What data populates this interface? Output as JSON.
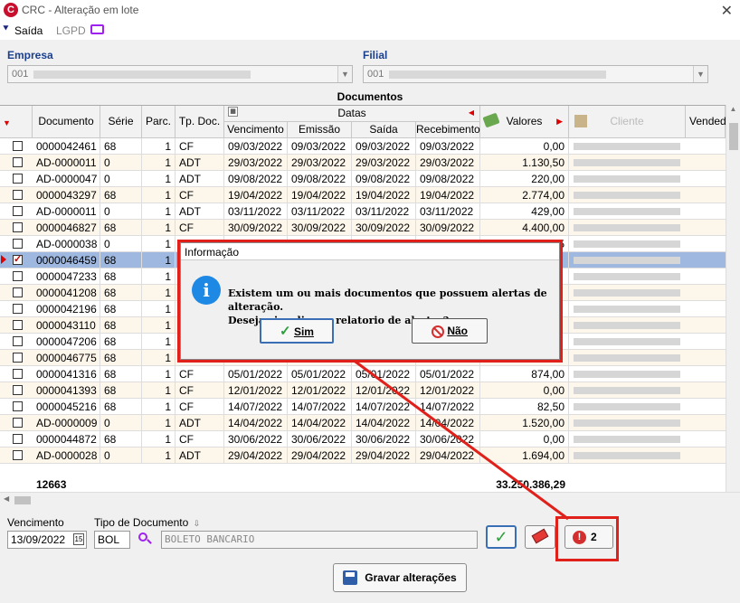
{
  "window": {
    "title": "CRC - Alteração em lote",
    "close": "✕"
  },
  "menu": {
    "saida": "Saída",
    "lgpd": "LGPD"
  },
  "empresa": {
    "label": "Empresa",
    "value": "001"
  },
  "filial": {
    "label": "Filial",
    "value": "001"
  },
  "documentos_title": "Documentos",
  "columns": {
    "documento": "Documento",
    "serie": "Série",
    "parc": "Parc.",
    "tpdoc": "Tp. Doc.",
    "datas": "Datas",
    "vencimento": "Vencimento",
    "emissao": "Emissão",
    "saida": "Saída",
    "recebimento": "Recebimento",
    "valores": "Valores",
    "cliente": "Cliente",
    "vendedor": "Vendedo"
  },
  "rows": [
    {
      "doc": "0000042461",
      "serie": "68",
      "parc": "1",
      "tp": "CF",
      "venc": "09/03/2022",
      "emis": "09/03/2022",
      "saida": "09/03/2022",
      "receb": "09/03/2022",
      "valor": "0,00"
    },
    {
      "doc": "AD-0000011",
      "serie": "0",
      "parc": "1",
      "tp": "ADT",
      "venc": "29/03/2022",
      "emis": "29/03/2022",
      "saida": "29/03/2022",
      "receb": "29/03/2022",
      "valor": "1.130,50"
    },
    {
      "doc": "AD-0000047",
      "serie": "0",
      "parc": "1",
      "tp": "ADT",
      "venc": "09/08/2022",
      "emis": "09/08/2022",
      "saida": "09/08/2022",
      "receb": "09/08/2022",
      "valor": "220,00"
    },
    {
      "doc": "0000043297",
      "serie": "68",
      "parc": "1",
      "tp": "CF",
      "venc": "19/04/2022",
      "emis": "19/04/2022",
      "saida": "19/04/2022",
      "receb": "19/04/2022",
      "valor": "2.774,00"
    },
    {
      "doc": "AD-0000011",
      "serie": "0",
      "parc": "1",
      "tp": "ADT",
      "venc": "03/11/2022",
      "emis": "03/11/2022",
      "saida": "03/11/2022",
      "receb": "03/11/2022",
      "valor": "429,00"
    },
    {
      "doc": "0000046827",
      "serie": "68",
      "parc": "1",
      "tp": "CF",
      "venc": "30/09/2022",
      "emis": "30/09/2022",
      "saida": "30/09/2022",
      "receb": "30/09/2022",
      "valor": "4.400,00"
    },
    {
      "doc": "AD-0000038",
      "serie": "0",
      "parc": "1",
      "tp": "",
      "venc": "",
      "emis": "",
      "saida": "",
      "receb": "",
      "valor": "5"
    },
    {
      "doc": "0000046459",
      "serie": "68",
      "parc": "1",
      "tp": "",
      "venc": "",
      "emis": "",
      "saida": "",
      "receb": "",
      "valor": ""
    },
    {
      "doc": "0000047233",
      "serie": "68",
      "parc": "1",
      "tp": "",
      "venc": "",
      "emis": "",
      "saida": "",
      "receb": "",
      "valor": ""
    },
    {
      "doc": "0000041208",
      "serie": "68",
      "parc": "1",
      "tp": "",
      "venc": "",
      "emis": "",
      "saida": "",
      "receb": "",
      "valor": ""
    },
    {
      "doc": "0000042196",
      "serie": "68",
      "parc": "1",
      "tp": "",
      "venc": "",
      "emis": "",
      "saida": "",
      "receb": "",
      "valor": ""
    },
    {
      "doc": "0000043110",
      "serie": "68",
      "parc": "1",
      "tp": "",
      "venc": "",
      "emis": "",
      "saida": "",
      "receb": "",
      "valor": ""
    },
    {
      "doc": "0000047206",
      "serie": "68",
      "parc": "1",
      "tp": "",
      "venc": "",
      "emis": "",
      "saida": "",
      "receb": "",
      "valor": ""
    },
    {
      "doc": "0000046775",
      "serie": "68",
      "parc": "1",
      "tp": "",
      "venc": "",
      "emis": "",
      "saida": "",
      "receb": "",
      "valor": ""
    },
    {
      "doc": "0000041316",
      "serie": "68",
      "parc": "1",
      "tp": "CF",
      "venc": "05/01/2022",
      "emis": "05/01/2022",
      "saida": "05/01/2022",
      "receb": "05/01/2022",
      "valor": "874,00"
    },
    {
      "doc": "0000041393",
      "serie": "68",
      "parc": "1",
      "tp": "CF",
      "venc": "12/01/2022",
      "emis": "12/01/2022",
      "saida": "12/01/2022",
      "receb": "12/01/2022",
      "valor": "0,00"
    },
    {
      "doc": "0000045216",
      "serie": "68",
      "parc": "1",
      "tp": "CF",
      "venc": "14/07/2022",
      "emis": "14/07/2022",
      "saida": "14/07/2022",
      "receb": "14/07/2022",
      "valor": "82,50"
    },
    {
      "doc": "AD-0000009",
      "serie": "0",
      "parc": "1",
      "tp": "ADT",
      "venc": "14/04/2022",
      "emis": "14/04/2022",
      "saida": "14/04/2022",
      "receb": "14/04/2022",
      "valor": "1.520,00"
    },
    {
      "doc": "0000044872",
      "serie": "68",
      "parc": "1",
      "tp": "CF",
      "venc": "30/06/2022",
      "emis": "30/06/2022",
      "saida": "30/06/2022",
      "receb": "30/06/2022",
      "valor": "0,00"
    },
    {
      "doc": "AD-0000028",
      "serie": "0",
      "parc": "1",
      "tp": "ADT",
      "venc": "29/04/2022",
      "emis": "29/04/2022",
      "saida": "29/04/2022",
      "receb": "29/04/2022",
      "valor": "1.694,00"
    }
  ],
  "selected_row": 7,
  "totals": {
    "count": "12663",
    "sum": "33.250.386,29"
  },
  "bottom": {
    "vencimento_label": "Vencimento",
    "vencimento_value": "13/09/2022",
    "tipo_label": "Tipo de Documento",
    "tipo_code": "BOL",
    "tipo_desc": "BOLETO BANCARIO",
    "alert_count": "2",
    "gravar": "Gravar alterações"
  },
  "dialog": {
    "title": "Informação",
    "line1": "Existem um ou mais documentos que possuem alertas de alteração.",
    "line2": "Deseja visualizar o relatorio de alertas?",
    "sim": "Sim",
    "nao": "Não"
  },
  "colors": {
    "highlight": "#e0201a",
    "selected_row": "#9fb8e0",
    "alt_row": "#fdf6ea"
  }
}
